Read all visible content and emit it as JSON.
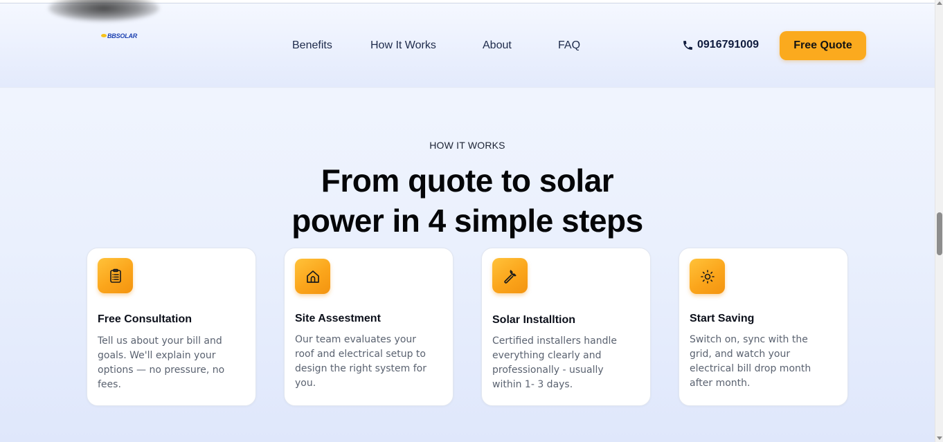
{
  "header": {
    "logo_text": "BBSOLAR",
    "nav": [
      {
        "label": "Benefits"
      },
      {
        "label": "How It Works"
      },
      {
        "label": "About"
      },
      {
        "label": "FAQ"
      }
    ],
    "phone": "0916791009",
    "quote_button": "Free Quote"
  },
  "section": {
    "eyebrow": "HOW IT WORKS",
    "title_line1": "From quote to solar",
    "title_line2": "power in 4 simple steps",
    "steps": [
      {
        "icon": "clipboard-icon",
        "title": "Free Consultation",
        "description": "Tell us about your bill and goals. We'll explain your options — no pressure, no fees."
      },
      {
        "icon": "home-icon",
        "title": "Site Assestment",
        "description": "Our team evaluates your roof and electrical setup to design the right system for you."
      },
      {
        "icon": "wrench-icon",
        "title": "Solar Installtion",
        "description": "Certified installers handle everything clearly and professionally - usually within 1- 3 days."
      },
      {
        "icon": "sun-icon",
        "title": "Start Saving",
        "description": "Switch on, sync with the grid, and watch your electrical bill drop month after month."
      }
    ]
  },
  "colors": {
    "accent": "#fbaa1e",
    "navy_text": "#1d2a4a",
    "logo_blue": "#1a3fb0"
  }
}
